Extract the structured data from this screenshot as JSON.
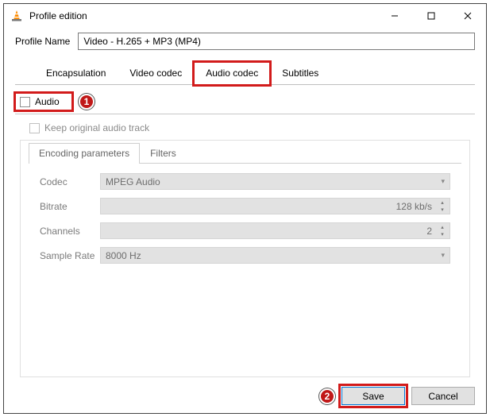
{
  "window": {
    "title": "Profile edition"
  },
  "profile": {
    "label": "Profile Name",
    "value": "Video - H.265 + MP3 (MP4)"
  },
  "tabs": {
    "encapsulation": "Encapsulation",
    "video_codec": "Video codec",
    "audio_codec": "Audio codec",
    "subtitles": "Subtitles"
  },
  "audio": {
    "checkbox_label": "Audio",
    "keep_original": "Keep original audio track",
    "subtabs": {
      "encoding": "Encoding parameters",
      "filters": "Filters"
    },
    "fields": {
      "codec_label": "Codec",
      "codec_value": "MPEG Audio",
      "bitrate_label": "Bitrate",
      "bitrate_value": "128 kb/s",
      "channels_label": "Channels",
      "channels_value": "2",
      "sample_rate_label": "Sample Rate",
      "sample_rate_value": "8000 Hz"
    }
  },
  "footer": {
    "save": "Save",
    "cancel": "Cancel"
  },
  "annotations": {
    "badge1": "1",
    "badge2": "2"
  }
}
